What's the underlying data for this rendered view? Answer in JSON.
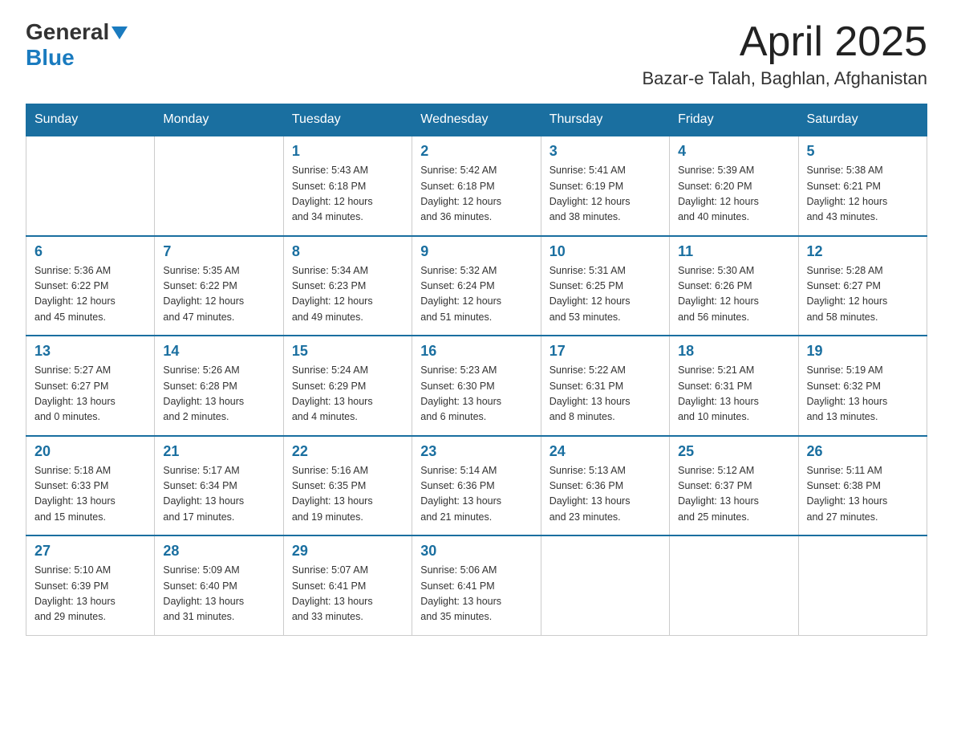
{
  "header": {
    "logo_general": "General",
    "logo_blue": "Blue",
    "month_title": "April 2025",
    "location": "Bazar-e Talah, Baghlan, Afghanistan"
  },
  "weekdays": [
    "Sunday",
    "Monday",
    "Tuesday",
    "Wednesday",
    "Thursday",
    "Friday",
    "Saturday"
  ],
  "weeks": [
    [
      {
        "day": "",
        "info": ""
      },
      {
        "day": "",
        "info": ""
      },
      {
        "day": "1",
        "info": "Sunrise: 5:43 AM\nSunset: 6:18 PM\nDaylight: 12 hours\nand 34 minutes."
      },
      {
        "day": "2",
        "info": "Sunrise: 5:42 AM\nSunset: 6:18 PM\nDaylight: 12 hours\nand 36 minutes."
      },
      {
        "day": "3",
        "info": "Sunrise: 5:41 AM\nSunset: 6:19 PM\nDaylight: 12 hours\nand 38 minutes."
      },
      {
        "day": "4",
        "info": "Sunrise: 5:39 AM\nSunset: 6:20 PM\nDaylight: 12 hours\nand 40 minutes."
      },
      {
        "day": "5",
        "info": "Sunrise: 5:38 AM\nSunset: 6:21 PM\nDaylight: 12 hours\nand 43 minutes."
      }
    ],
    [
      {
        "day": "6",
        "info": "Sunrise: 5:36 AM\nSunset: 6:22 PM\nDaylight: 12 hours\nand 45 minutes."
      },
      {
        "day": "7",
        "info": "Sunrise: 5:35 AM\nSunset: 6:22 PM\nDaylight: 12 hours\nand 47 minutes."
      },
      {
        "day": "8",
        "info": "Sunrise: 5:34 AM\nSunset: 6:23 PM\nDaylight: 12 hours\nand 49 minutes."
      },
      {
        "day": "9",
        "info": "Sunrise: 5:32 AM\nSunset: 6:24 PM\nDaylight: 12 hours\nand 51 minutes."
      },
      {
        "day": "10",
        "info": "Sunrise: 5:31 AM\nSunset: 6:25 PM\nDaylight: 12 hours\nand 53 minutes."
      },
      {
        "day": "11",
        "info": "Sunrise: 5:30 AM\nSunset: 6:26 PM\nDaylight: 12 hours\nand 56 minutes."
      },
      {
        "day": "12",
        "info": "Sunrise: 5:28 AM\nSunset: 6:27 PM\nDaylight: 12 hours\nand 58 minutes."
      }
    ],
    [
      {
        "day": "13",
        "info": "Sunrise: 5:27 AM\nSunset: 6:27 PM\nDaylight: 13 hours\nand 0 minutes."
      },
      {
        "day": "14",
        "info": "Sunrise: 5:26 AM\nSunset: 6:28 PM\nDaylight: 13 hours\nand 2 minutes."
      },
      {
        "day": "15",
        "info": "Sunrise: 5:24 AM\nSunset: 6:29 PM\nDaylight: 13 hours\nand 4 minutes."
      },
      {
        "day": "16",
        "info": "Sunrise: 5:23 AM\nSunset: 6:30 PM\nDaylight: 13 hours\nand 6 minutes."
      },
      {
        "day": "17",
        "info": "Sunrise: 5:22 AM\nSunset: 6:31 PM\nDaylight: 13 hours\nand 8 minutes."
      },
      {
        "day": "18",
        "info": "Sunrise: 5:21 AM\nSunset: 6:31 PM\nDaylight: 13 hours\nand 10 minutes."
      },
      {
        "day": "19",
        "info": "Sunrise: 5:19 AM\nSunset: 6:32 PM\nDaylight: 13 hours\nand 13 minutes."
      }
    ],
    [
      {
        "day": "20",
        "info": "Sunrise: 5:18 AM\nSunset: 6:33 PM\nDaylight: 13 hours\nand 15 minutes."
      },
      {
        "day": "21",
        "info": "Sunrise: 5:17 AM\nSunset: 6:34 PM\nDaylight: 13 hours\nand 17 minutes."
      },
      {
        "day": "22",
        "info": "Sunrise: 5:16 AM\nSunset: 6:35 PM\nDaylight: 13 hours\nand 19 minutes."
      },
      {
        "day": "23",
        "info": "Sunrise: 5:14 AM\nSunset: 6:36 PM\nDaylight: 13 hours\nand 21 minutes."
      },
      {
        "day": "24",
        "info": "Sunrise: 5:13 AM\nSunset: 6:36 PM\nDaylight: 13 hours\nand 23 minutes."
      },
      {
        "day": "25",
        "info": "Sunrise: 5:12 AM\nSunset: 6:37 PM\nDaylight: 13 hours\nand 25 minutes."
      },
      {
        "day": "26",
        "info": "Sunrise: 5:11 AM\nSunset: 6:38 PM\nDaylight: 13 hours\nand 27 minutes."
      }
    ],
    [
      {
        "day": "27",
        "info": "Sunrise: 5:10 AM\nSunset: 6:39 PM\nDaylight: 13 hours\nand 29 minutes."
      },
      {
        "day": "28",
        "info": "Sunrise: 5:09 AM\nSunset: 6:40 PM\nDaylight: 13 hours\nand 31 minutes."
      },
      {
        "day": "29",
        "info": "Sunrise: 5:07 AM\nSunset: 6:41 PM\nDaylight: 13 hours\nand 33 minutes."
      },
      {
        "day": "30",
        "info": "Sunrise: 5:06 AM\nSunset: 6:41 PM\nDaylight: 13 hours\nand 35 minutes."
      },
      {
        "day": "",
        "info": ""
      },
      {
        "day": "",
        "info": ""
      },
      {
        "day": "",
        "info": ""
      }
    ]
  ]
}
